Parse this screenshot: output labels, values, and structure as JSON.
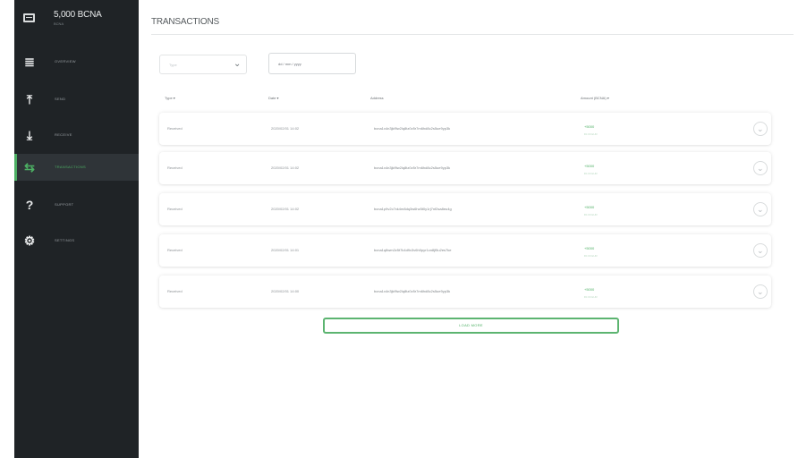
{
  "sidebar": {
    "balance": {
      "amount": "5,000 BCNA",
      "unit": "BCNA"
    },
    "items": [
      {
        "label": "Overview",
        "icon": "overview-icon",
        "glyph": "≣"
      },
      {
        "label": "Send",
        "icon": "send-icon",
        "glyph": "⤒"
      },
      {
        "label": "Receive",
        "icon": "receive-icon",
        "glyph": "⤓"
      },
      {
        "label": "Transactions",
        "icon": "transactions-icon",
        "glyph": "⇆",
        "active": true
      },
      {
        "label": "Support",
        "icon": "support-icon",
        "glyph": "?"
      },
      {
        "label": "Settings",
        "icon": "settings-icon",
        "glyph": "⚙"
      }
    ]
  },
  "main": {
    "title": "TRANSACTIONS",
    "filter": {
      "type_value": "Type",
      "date_value": "dd / mm / yyyy"
    },
    "columns": {
      "type": "Type ▾",
      "date": "Date ▾",
      "address": "Address",
      "amount": "Amount (BCNA) ▾"
    },
    "rows": [
      {
        "type": "Received",
        "date": "2020/02/01 14:02",
        "address": "bcna1x4n3jkf9w2lq8tz0v5r7m6hd8c2s5ue9yp3k",
        "amount": "+5000",
        "fiat": "€0.00 EUR"
      },
      {
        "type": "Received",
        "date": "2020/02/01 14:02",
        "address": "bcna1x4n3jkf9w2lq8tz0v5r7m6hd8c2s5ue9yp3k",
        "amount": "+5000",
        "fiat": "€0.00 EUR"
      },
      {
        "type": "Received",
        "date": "2020/02/01 14:02",
        "address": "bcna1p9v2c7xk4m8dq3w6hz5t0y1rj7nf2sa8eu4g",
        "amount": "+5000",
        "fiat": "€0.00 EUR"
      },
      {
        "type": "Received",
        "date": "2020/02/01 14:01",
        "address": "bcna1q8wm2z5t7k4d9x3v6h0pyr1cn8jf5u2es7ke",
        "amount": "+5000",
        "fiat": "€0.00 EUR"
      },
      {
        "type": "Received",
        "date": "2020/02/01 14:00",
        "address": "bcna1x4n3jkf9w2lq8tz0v5r7m6hd8c2s5ue9yp3k",
        "amount": "+5000",
        "fiat": "€0.00 EUR"
      }
    ],
    "load_more": "Load more"
  }
}
